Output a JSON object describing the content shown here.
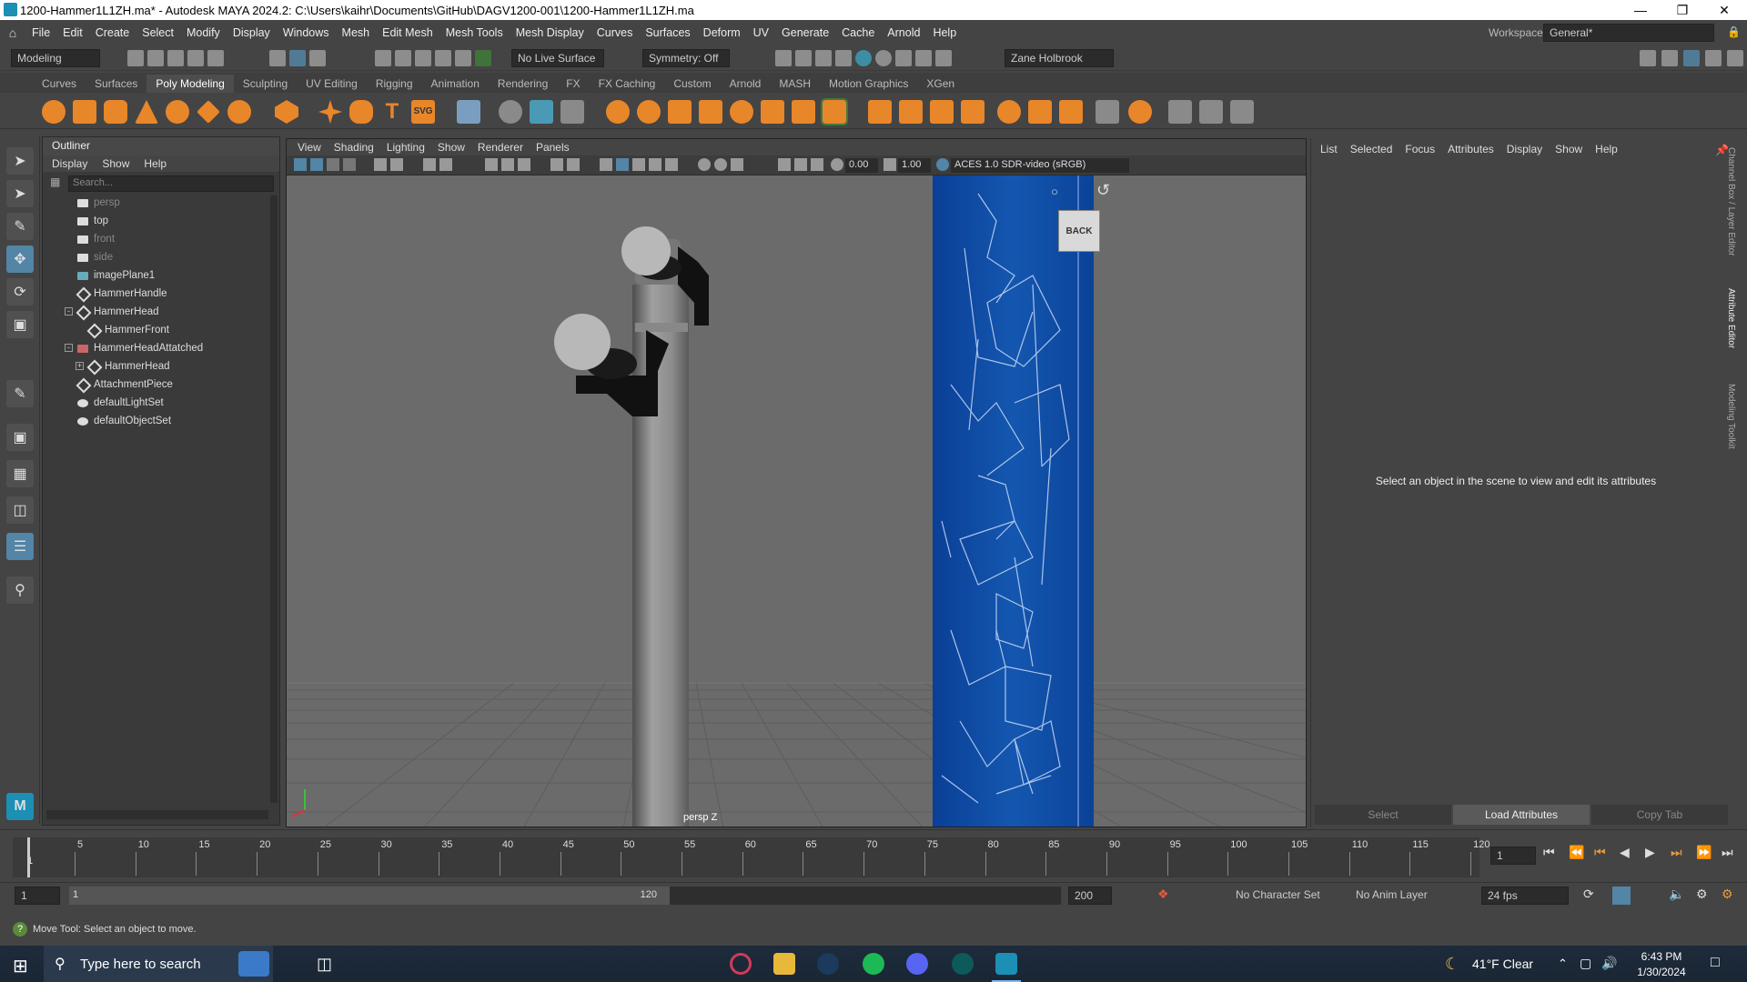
{
  "window": {
    "title": "1200-Hammer1L1ZH.ma* - Autodesk MAYA 2024.2: C:\\Users\\kaihr\\Documents\\GitHub\\DAGV1200-001\\1200-Hammer1L1ZH.ma"
  },
  "menubar": [
    "File",
    "Edit",
    "Create",
    "Select",
    "Modify",
    "Display",
    "Windows",
    "Mesh",
    "Edit Mesh",
    "Mesh Tools",
    "Mesh Display",
    "Curves",
    "Surfaces",
    "Deform",
    "UV",
    "Generate",
    "Cache",
    "Arnold",
    "Help"
  ],
  "workspace": {
    "label": "Workspace:",
    "value": "General*"
  },
  "statusline": {
    "mode": "Modeling",
    "live_surface": "No Live Surface",
    "symmetry": "Symmetry: Off",
    "user": "Zane Holbrook"
  },
  "shelf_tabs": [
    "Curves",
    "Surfaces",
    "Poly Modeling",
    "Sculpting",
    "UV Editing",
    "Rigging",
    "Animation",
    "Rendering",
    "FX",
    "FX Caching",
    "Custom",
    "Arnold",
    "MASH",
    "Motion Graphics",
    "XGen"
  ],
  "shelf_active": "Poly Modeling",
  "outliner": {
    "title": "Outliner",
    "menu": [
      "Display",
      "Show",
      "Help"
    ],
    "search_placeholder": "Search...",
    "items": [
      {
        "label": "persp"
      },
      {
        "label": "top"
      },
      {
        "label": "front"
      },
      {
        "label": "side"
      },
      {
        "label": "imagePlane1"
      },
      {
        "label": "HammerHandle"
      },
      {
        "label": "HammerHead"
      },
      {
        "label": "HammerFront"
      },
      {
        "label": "HammerHeadAttatched"
      },
      {
        "label": "HammerHead"
      },
      {
        "label": "AttachmentPiece"
      },
      {
        "label": "defaultLightSet"
      },
      {
        "label": "defaultObjectSet"
      }
    ]
  },
  "viewport": {
    "menu": [
      "View",
      "Shading",
      "Lighting",
      "Show",
      "Renderer",
      "Panels"
    ],
    "field_a": "0.00",
    "field_b": "1.00",
    "color_space": "ACES 1.0 SDR-video (sRGB)",
    "camera_label": "persp Z",
    "viewcube": "BACK"
  },
  "attr_editor": {
    "menu": [
      "List",
      "Selected",
      "Focus",
      "Attributes",
      "Display",
      "Show",
      "Help"
    ],
    "empty_message": "Select an object in the scene to view and edit its attributes",
    "buttons": [
      "Select",
      "Load Attributes",
      "Copy Tab"
    ],
    "side_tabs": [
      "Channel Box / Layer Editor",
      "Attribute Editor",
      "Modeling Toolkit"
    ]
  },
  "timeline": {
    "ticks": [
      "5",
      "10",
      "15",
      "20",
      "25",
      "30",
      "35",
      "40",
      "45",
      "50",
      "55",
      "60",
      "65",
      "70",
      "75",
      "80",
      "85",
      "90",
      "95",
      "100",
      "105",
      "110",
      "115",
      "120"
    ],
    "first_tick": "1",
    "current_frame": "1"
  },
  "range": {
    "start": "1",
    "inner_start": "1",
    "inner_end": "120",
    "end": "200",
    "character_set": "No Character Set",
    "anim_layer": "No Anim Layer",
    "fps": "24 fps"
  },
  "help_line": "Move Tool: Select an object to move.",
  "taskbar": {
    "search": "Type here to search",
    "weather": "41°F  Clear",
    "time": "6:43 PM",
    "date": "1/30/2024"
  },
  "colors": {
    "accent": "#5285a6",
    "blueprint": "#1650a6"
  }
}
